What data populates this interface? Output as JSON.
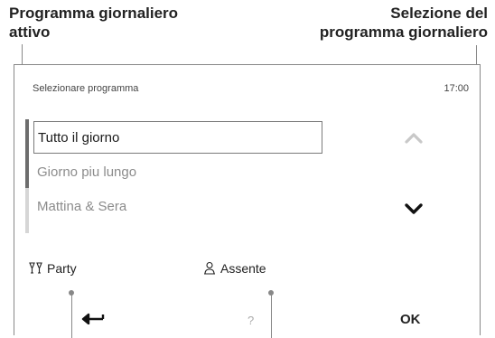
{
  "annotations": {
    "left_line1": "Programma giornaliero",
    "left_line2": "attivo",
    "right_line1": "Selezione del",
    "right_line2": "programma giornaliero"
  },
  "screen": {
    "title": "Selezionare programma",
    "time": "17:00",
    "programs": [
      {
        "label": "Tutto il giorno",
        "active": true
      },
      {
        "label": "Giorno piu lungo",
        "active": false
      },
      {
        "label": "Mattina & Sera",
        "active": false
      }
    ],
    "party_label": "Party",
    "absent_label": "Assente",
    "help_label": "?",
    "ok_label": "OK"
  },
  "icons": {
    "up": "chevron-up-icon",
    "down": "chevron-down-icon",
    "back": "back-arrow-icon",
    "party": "glasses-icon",
    "absent": "person-away-icon"
  },
  "colors": {
    "active_text": "#1a1a1a",
    "inactive_text": "#8c8c8c",
    "scroll_thumb": "#6d6d6d",
    "scroll_track": "#d6d6d6"
  }
}
